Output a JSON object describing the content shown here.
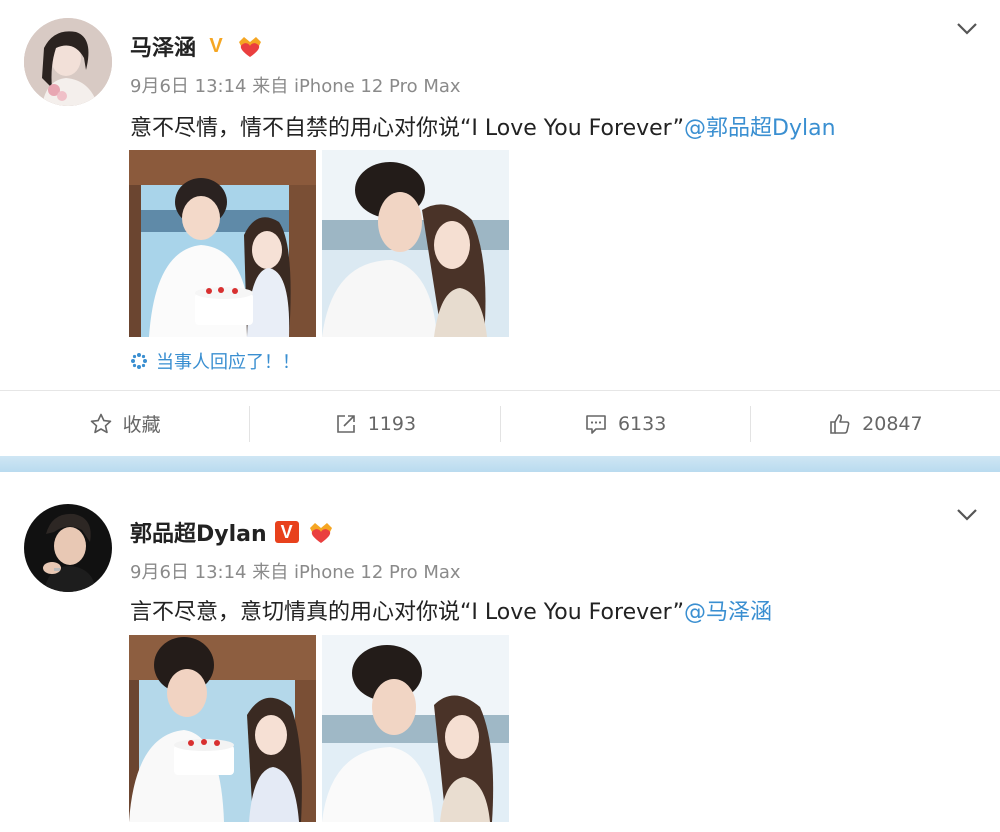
{
  "posts": [
    {
      "username": "马泽涵",
      "badge": "V",
      "time": "9月6日 13:14",
      "source": "来自 iPhone 12 Pro Max",
      "text": "意不尽情，情不自禁的用心对你说“I Love You Forever”",
      "mention": "@郭品超Dylan",
      "topic": "当事人回应了！！"
    },
    {
      "username": "郭品超Dylan",
      "badge": "V",
      "time": "9月6日 13:14",
      "source": "来自 iPhone 12 Pro Max",
      "text": "言不尽意，意切情真的用心对你说“I Love You Forever”",
      "mention": "@马泽涵"
    }
  ],
  "toolbar": {
    "favorite_label": "收藏",
    "repost_count": "1193",
    "comment_count": "6133",
    "like_count": "20847"
  },
  "colors": {
    "link": "#3a8fd1",
    "badge_gold": "#f5a623",
    "badge_red": "#e8411c",
    "separator": "#c4e0f2"
  },
  "icons": [
    "star-icon",
    "repost-icon",
    "comment-icon",
    "like-icon",
    "chevron-down-icon",
    "topic-icon",
    "crown-heart-icon"
  ]
}
